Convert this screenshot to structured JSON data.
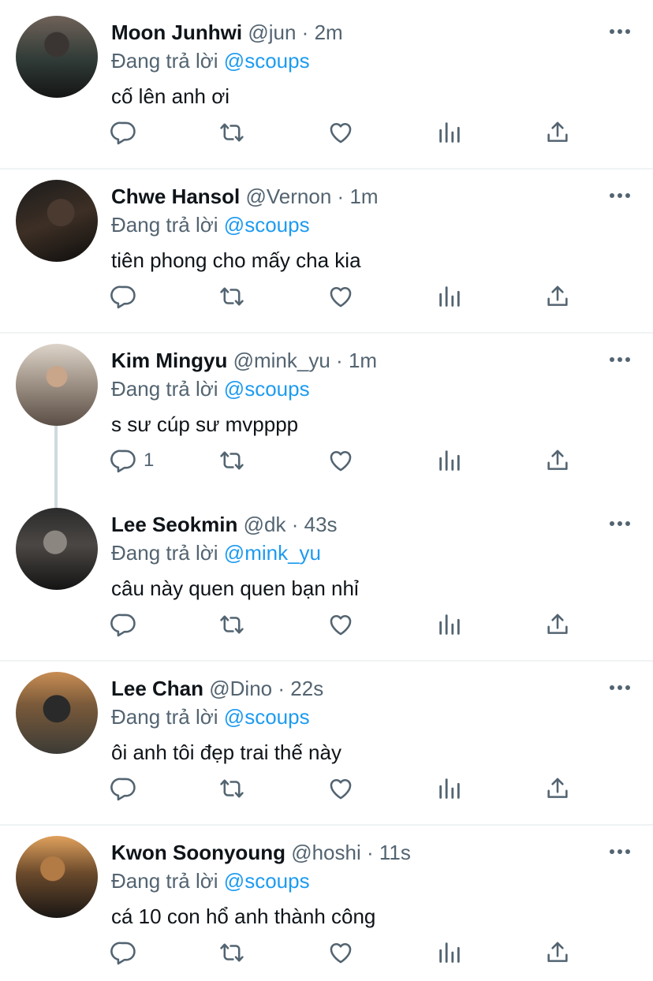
{
  "reply_prefix": "Đang trả lời",
  "colors": {
    "accent": "#1d9bf0",
    "secondary": "#536471",
    "primary": "#0f1419",
    "divider": "#eff3f4"
  },
  "tweets": [
    {
      "name": "Moon Junhwi",
      "handle": "@jun",
      "time": "2m",
      "reply_to": "@scoups",
      "text": "cố lên anh ơi",
      "reply_count": ""
    },
    {
      "name": "Chwe Hansol",
      "handle": "@Vernon",
      "time": "1m",
      "reply_to": "@scoups",
      "text": "tiên phong cho mấy cha kia",
      "reply_count": ""
    },
    {
      "name": "Kim Mingyu",
      "handle": "@mink_yu",
      "time": "1m",
      "reply_to": "@scoups",
      "text": "s sư cúp sư mvpppp",
      "reply_count": "1"
    },
    {
      "name": "Lee Seokmin",
      "handle": "@dk",
      "time": "43s",
      "reply_to": "@mink_yu",
      "text": "câu này quen quen bạn nhỉ",
      "reply_count": ""
    },
    {
      "name": "Lee Chan",
      "handle": "@Dino",
      "time": "22s",
      "reply_to": "@scoups",
      "text": "ôi anh tôi đẹp trai thế này",
      "reply_count": ""
    },
    {
      "name": "Kwon Soonyoung",
      "handle": "@hoshi",
      "time": "11s",
      "reply_to": "@scoups",
      "text": "cá 10 con hổ anh thành công",
      "reply_count": ""
    }
  ]
}
